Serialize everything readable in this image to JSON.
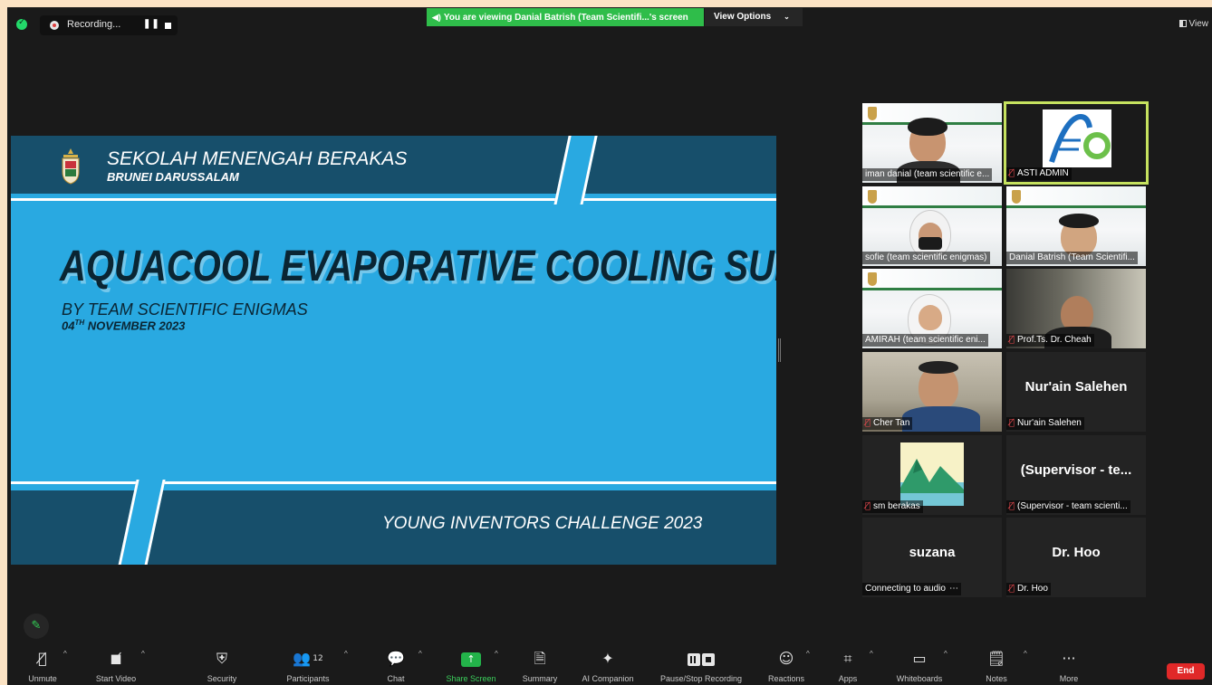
{
  "topbar": {
    "recording_text": "Recording...",
    "viewing_text": "You are viewing Danial Batrish (Team Scientifi...'s screen",
    "view_options_label": "View Options",
    "view_label": "View"
  },
  "slide": {
    "school_name": "SEKOLAH MENENGAH BERAKAS",
    "school_location": "BRUNEI DARUSSALAM",
    "title": "AQUACOOL EVAPORATIVE COOLING SUIT",
    "byline": "BY TEAM SCIENTIFIC ENIGMAS",
    "date_prefix": "04",
    "date_sup": "TH",
    "date_suffix": " NOVEMBER 2023",
    "footer": "YOUNG INVENTORS CHALLENGE 2023"
  },
  "participants": [
    {
      "name": "iman danial (team scientific e...",
      "muted": false
    },
    {
      "name": "ASTI ADMIN",
      "muted": true
    },
    {
      "name": "sofie (team scientific enigmas)",
      "muted": false
    },
    {
      "name": "Danial Batrish (Team Scientifi...",
      "muted": false
    },
    {
      "name": "AMIRAH  (team scientific eni...",
      "muted": false
    },
    {
      "name": "Prof.Ts. Dr. Cheah",
      "muted": true
    },
    {
      "name": "Cher Tan",
      "muted": true
    },
    {
      "name": "Nur'ain Salehen",
      "display": "Nur'ain Salehen",
      "muted": true
    },
    {
      "name": "sm berakas",
      "muted": true
    },
    {
      "name": "(Supervisor - team scienti...",
      "display": "(Supervisor - te...",
      "muted": true
    },
    {
      "name": "Connecting to audio",
      "display": "suzana",
      "muted": false
    },
    {
      "name": "Dr. Hoo",
      "display": "Dr. Hoo",
      "muted": true
    }
  ],
  "toolbar": {
    "unmute": "Unmute",
    "start_video": "Start Video",
    "security": "Security",
    "participants": "Participants",
    "participants_count": "12",
    "chat": "Chat",
    "share_screen": "Share Screen",
    "summary": "Summary",
    "ai_companion": "AI Companion",
    "pause_stop": "Pause/Stop Recording",
    "reactions": "Reactions",
    "apps": "Apps",
    "whiteboards": "Whiteboards",
    "notes": "Notes",
    "more": "More",
    "end": "End"
  },
  "colors": {
    "accent_green": "#2fbd4a",
    "end_red": "#e02828",
    "slide_blue": "#29a9e1",
    "slide_navy": "#174f6b",
    "active_speaker": "#c6e25f"
  }
}
